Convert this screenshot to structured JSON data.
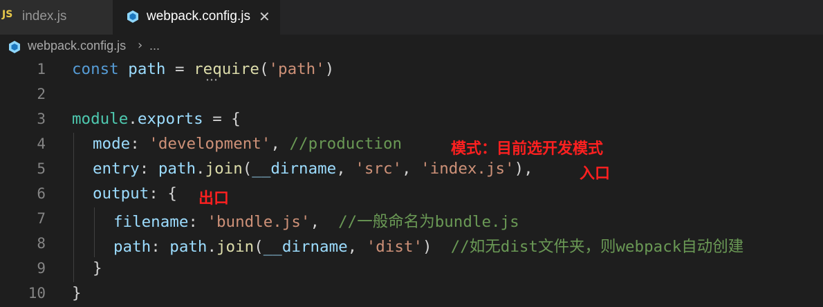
{
  "tabs": [
    {
      "badge": "JS",
      "label": "index.js",
      "active": false
    },
    {
      "label": "webpack.config.js",
      "active": true,
      "close": "✕"
    }
  ],
  "breadcrumb": {
    "file": "webpack.config.js",
    "separator": "›",
    "more": "..."
  },
  "lines": [
    "1",
    "2",
    "3",
    "4",
    "5",
    "6",
    "7",
    "8",
    "9",
    "10"
  ],
  "annotations": {
    "mode": "模式：目前选开发模式",
    "entry": "入口",
    "output": "出口"
  },
  "code": {
    "l1": {
      "kw": "const",
      "var": "path",
      "op": " = ",
      "fn": "require",
      "p1": "(",
      "str": "'path'",
      "p2": ")"
    },
    "l3": {
      "mod": "module",
      "dot": ".",
      "var": "exports",
      "rest": " = {"
    },
    "l4": {
      "key": "mode",
      "colon": ": ",
      "str": "'development'",
      "comma": ", ",
      "cmt": "//production"
    },
    "l5": {
      "key": "entry",
      "colon": ": ",
      "obj": "path",
      "dot": ".",
      "fn": "join",
      "p1": "(",
      "var": "__dirname",
      "c1": ", ",
      "s1": "'src'",
      "c2": ", ",
      "s2": "'index.js'",
      "p2": "),"
    },
    "l6": {
      "key": "output",
      "rest": ": {"
    },
    "l7": {
      "key": "filename",
      "colon": ": ",
      "str": "'bundle.js'",
      "comma": ",  ",
      "cmt": "//一般命名为bundle.js"
    },
    "l8": {
      "key": "path",
      "colon": ": ",
      "obj": "path",
      "dot": ".",
      "fn": "join",
      "p1": "(",
      "var": "__dirname",
      "c1": ", ",
      "str": "'dist'",
      "p2": ")  ",
      "cmt": "//如无dist文件夹，则webpack自动创建"
    },
    "l9": {
      "rest": "}"
    },
    "l10": {
      "rest": "}"
    }
  },
  "colors": {
    "background": "#1e1e1e",
    "keyword": "#569cd6",
    "string": "#ce9178",
    "comment": "#6a9955",
    "annotation": "#ff2020"
  }
}
